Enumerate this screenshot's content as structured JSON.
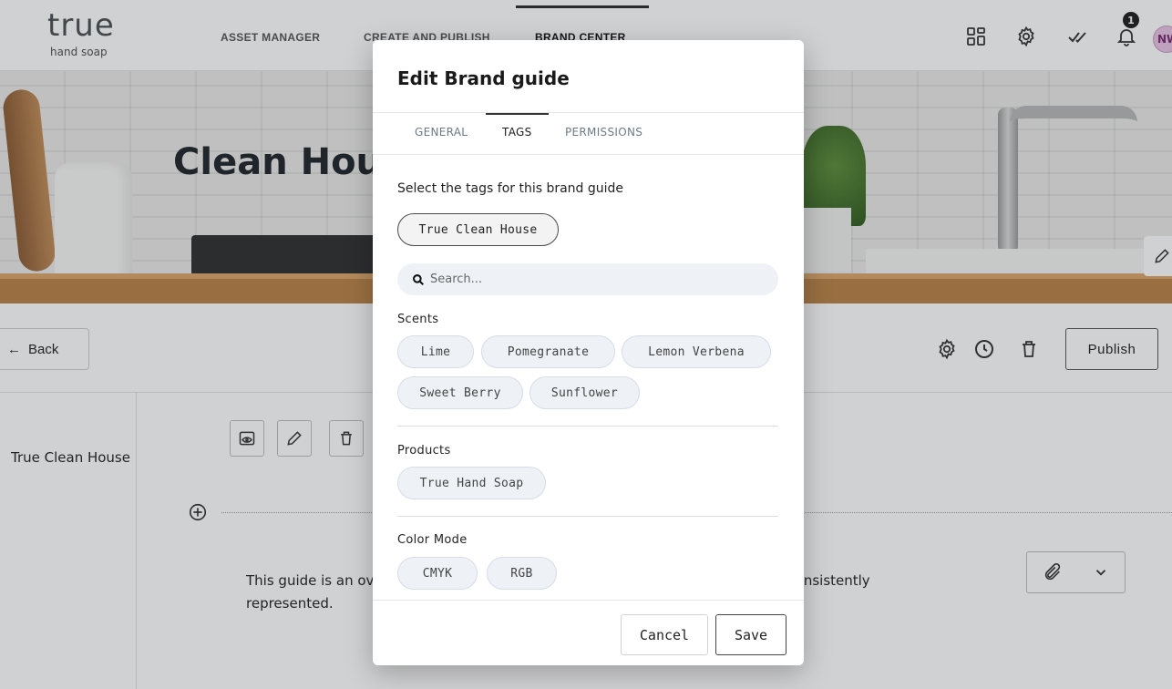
{
  "brand": {
    "logo_word": "true",
    "logo_sub": "hand soap"
  },
  "topnav": {
    "links": [
      "ASSET MANAGER",
      "CREATE AND PUBLISH",
      "BRAND CENTER"
    ],
    "notification_count": "1",
    "avatar_initials": "NW",
    "icons": [
      "apps-grid-icon",
      "gear-icon",
      "checkmark-icon",
      "bell-icon"
    ]
  },
  "hero": {
    "title": "Clean House"
  },
  "toolbar": {
    "back_label": "Back",
    "publish_label": "Publish"
  },
  "left_panel": {
    "label": "True Clean House"
  },
  "content": {
    "paragraph": "This guide is an overview of the True Clean House brand, and how it should be consistently represented."
  },
  "modal": {
    "title": "Edit Brand guide",
    "tabs": [
      {
        "label": "GENERAL",
        "active": false
      },
      {
        "label": "TAGS",
        "active": true
      },
      {
        "label": "PERMISSIONS",
        "active": false
      }
    ],
    "prompt": "Select the tags for this brand guide",
    "selected_tags": [
      "True Clean House"
    ],
    "search": {
      "placeholder": "Search..."
    },
    "groups": [
      {
        "label": "Scents",
        "tags": [
          "Lime",
          "Pomegranate",
          "Lemon Verbena",
          "Sweet Berry",
          "Sunflower"
        ]
      },
      {
        "label": "Products",
        "tags": [
          "True Hand Soap"
        ]
      },
      {
        "label": "Color Mode",
        "tags": [
          "CMYK",
          "RGB"
        ]
      }
    ],
    "footer": {
      "cancel_label": "Cancel",
      "save_label": "Save"
    }
  },
  "colors": {
    "overlay": "#282c30",
    "chip_bg": "#eef2f6",
    "avatar_bg": "#e7c2e4"
  }
}
